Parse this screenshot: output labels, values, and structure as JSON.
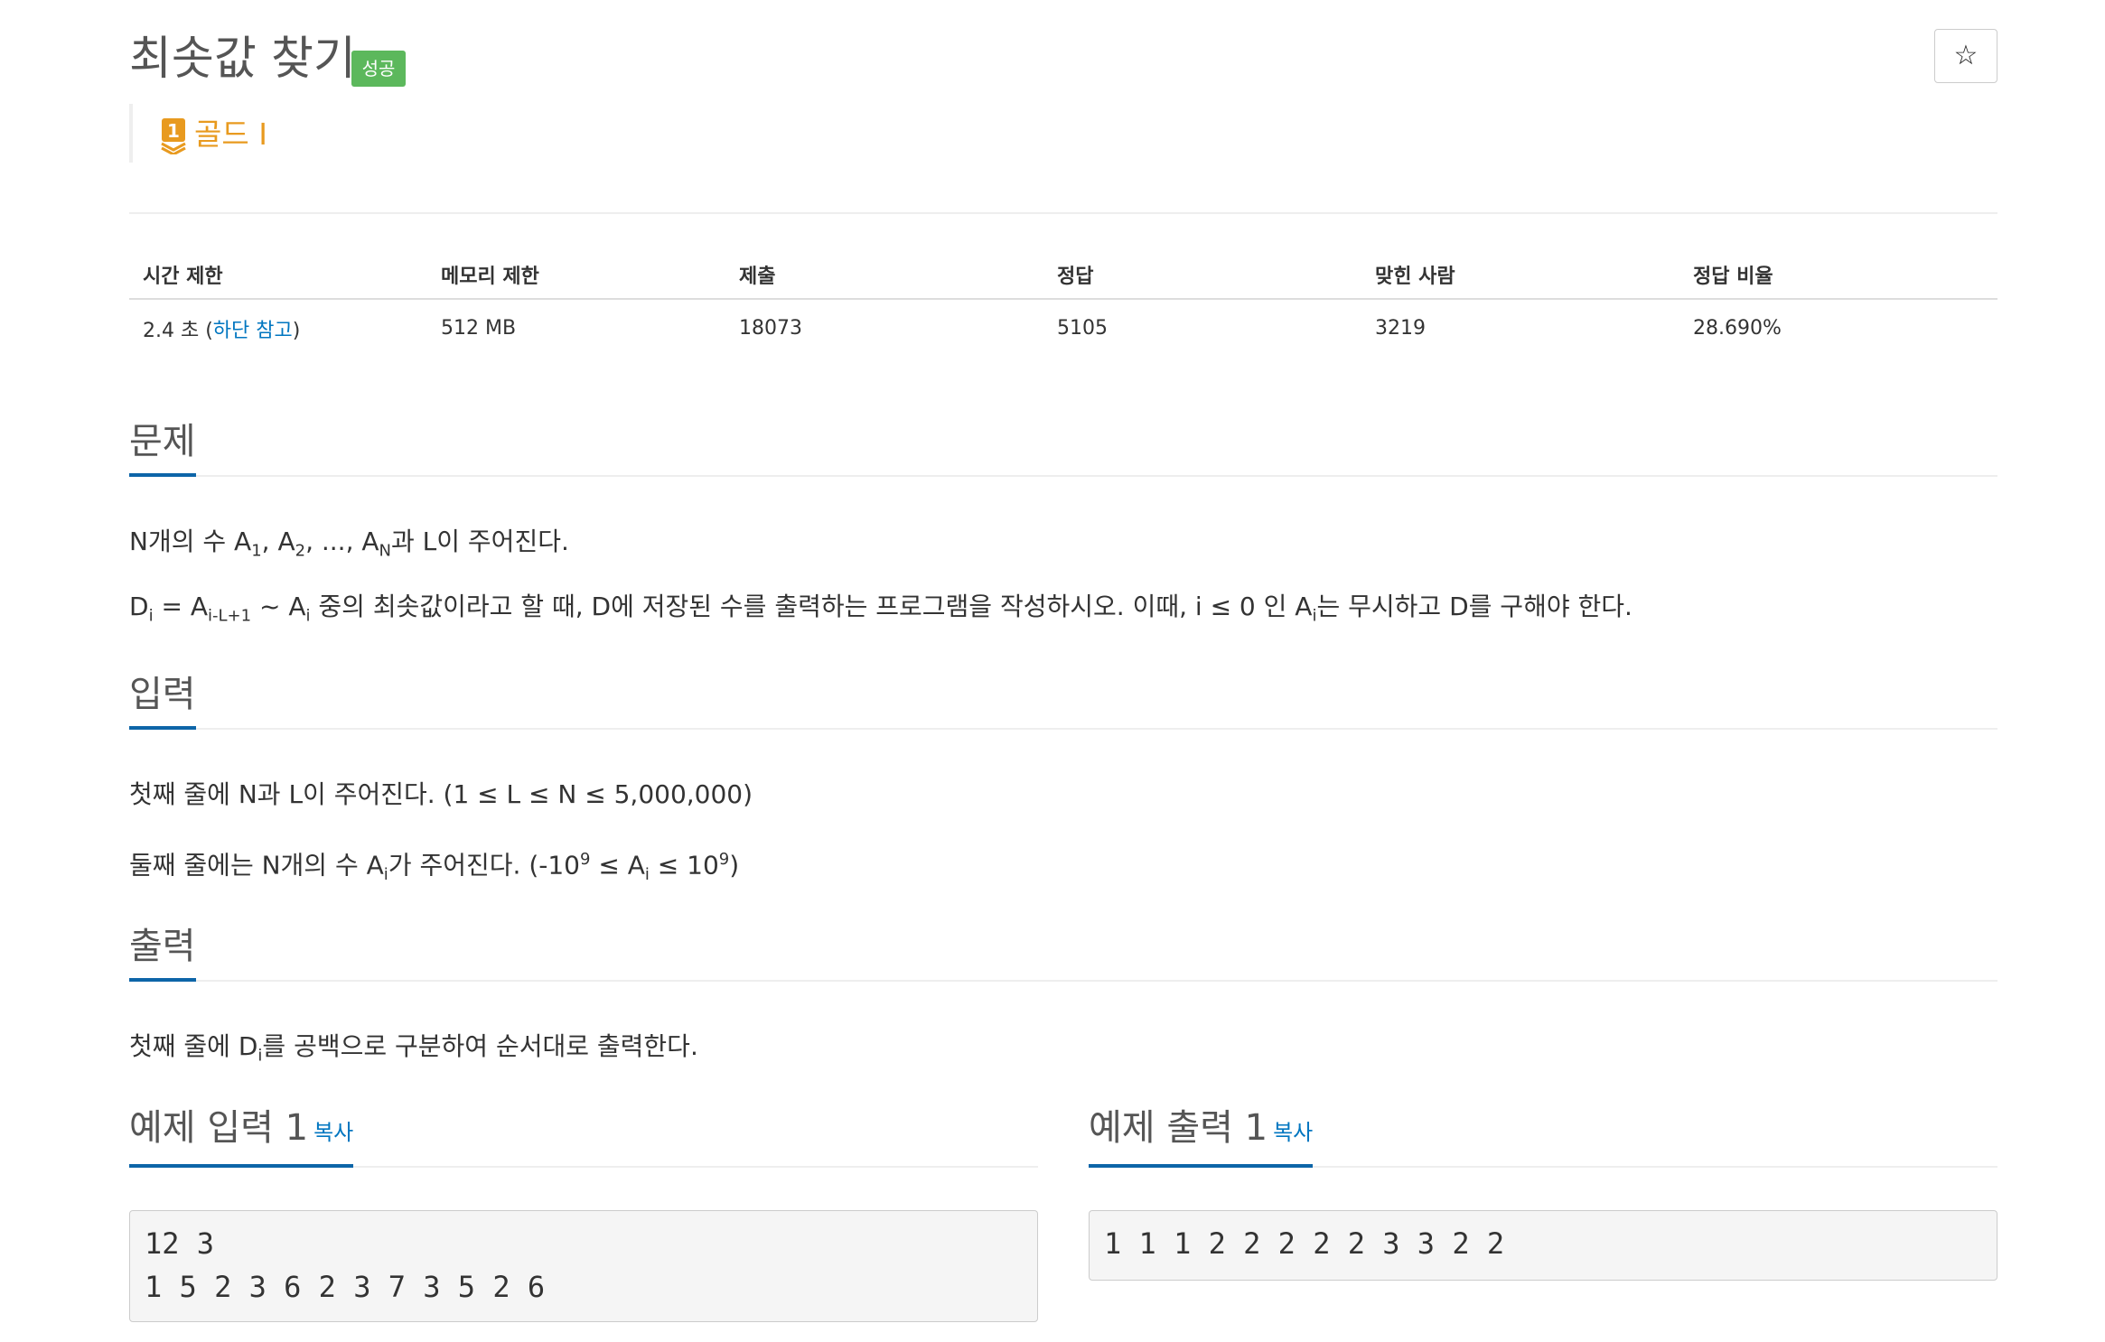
{
  "problem": {
    "title": "최솟값 찾기",
    "status_badge": "성공",
    "star_icon": "star-icon",
    "tier": {
      "label": "골드 I",
      "digit": "1",
      "color": "#e89a1f"
    }
  },
  "info_table": {
    "headers": [
      "시간 제한",
      "메모리 제한",
      "제출",
      "정답",
      "맞힌 사람",
      "정답 비율"
    ],
    "time_limit_prefix": "2.4 초 (",
    "time_limit_link": "하단 참고",
    "time_limit_suffix": ")",
    "memory_limit": "512 MB",
    "submissions": "18073",
    "accepted": "5105",
    "solvers": "3219",
    "ratio": "28.690%"
  },
  "sections": {
    "problem_heading": "문제",
    "input_heading": "입력",
    "output_heading": "출력"
  },
  "description": {
    "line1": {
      "t1": "N개의 수 A",
      "s1": "1",
      "t2": ", A",
      "s2": "2",
      "t3": ", ..., A",
      "s3": "N",
      "t4": "과 L이 주어진다."
    },
    "line2": {
      "t1": "D",
      "s1": "i",
      "t2": " = A",
      "s2": "i-L+1",
      "t3": " ~ A",
      "s3": "i",
      "t4": " 중의 최솟값이라고 할 때, D에 저장된 수를 출력하는 프로그램을 작성하시오. 이때, i ≤ 0 인 A",
      "s4": "i",
      "t5": "는 무시하고 D를 구해야 한다."
    }
  },
  "input_desc": {
    "line1": "첫째 줄에 N과 L이 주어진다. (1 ≤ L ≤ N ≤ 5,000,000)",
    "line2": {
      "t1": "둘째 줄에는 N개의 수 A",
      "s1": "i",
      "t2": "가 주어진다. (-10",
      "p1": "9",
      "t3": " ≤ A",
      "s2": "i",
      "t4": " ≤ 10",
      "p2": "9",
      "t5": ")"
    }
  },
  "output_desc": {
    "t1": "첫째 줄에 D",
    "s1": "i",
    "t2": "를 공백으로 구분하여 순서대로 출력한다."
  },
  "samples": {
    "input_title": "예제 입력 1",
    "output_title": "예제 출력 1",
    "copy_label": "복사",
    "input_text": "12 3\n1 5 2 3 6 2 3 7 3 5 2 6",
    "output_text": "1 1 1 2 2 2 2 2 3 3 2 2"
  }
}
